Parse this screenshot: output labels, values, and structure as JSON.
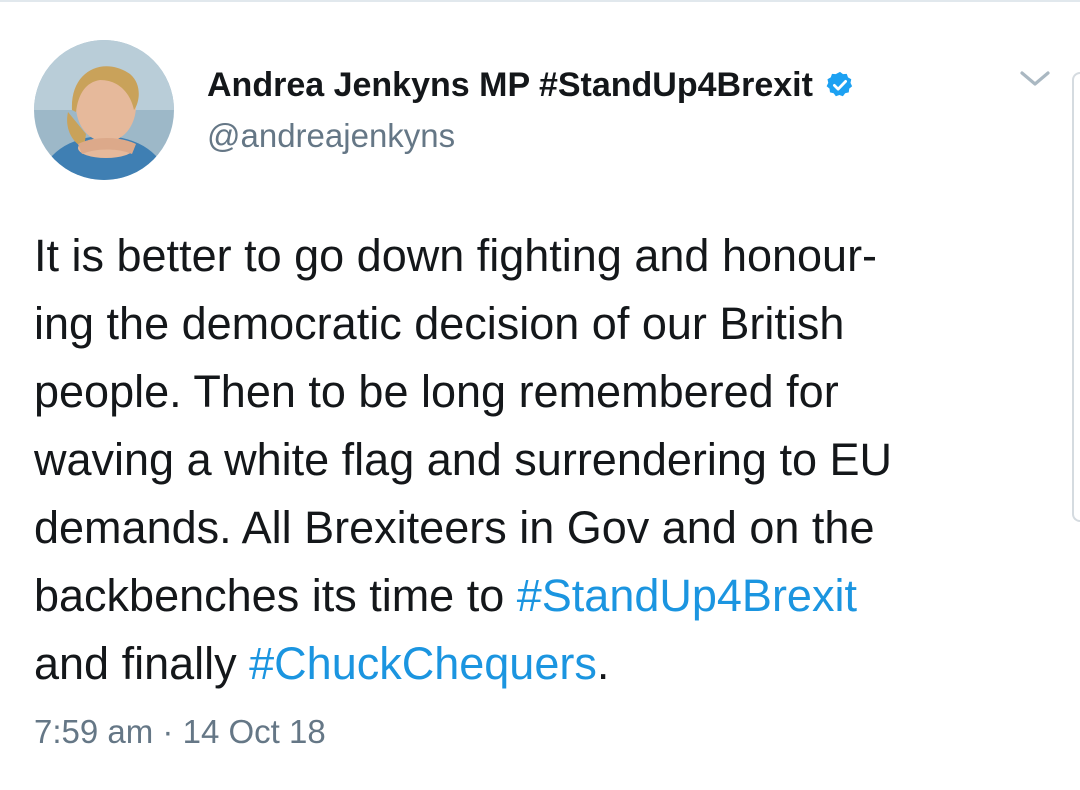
{
  "author": {
    "display_name": "Andrea Jenkyns MP #StandUp4Brexit",
    "handle": "@andreajenkyns",
    "verified": true
  },
  "tweet": {
    "lines": [
      {
        "text": "It is better to go down fighting and honour-"
      },
      {
        "text": "ing the democratic decision of our British"
      },
      {
        "text": "people. Then to be long remembered for"
      },
      {
        "text": "waving a white flag and surrendering to EU"
      },
      {
        "text": "demands. All Brexiteers in Gov and on the"
      },
      {
        "text": "backbenches its time to ",
        "hashtag": "#StandUp4Brexit"
      },
      {
        "text": "and finally ",
        "hashtag": "#ChuckChequers",
        "suffix": "."
      }
    ]
  },
  "meta": {
    "time": "7:59 am",
    "separator": "·",
    "date": "14 Oct 18"
  },
  "icons": {
    "verified": "verified-badge-icon",
    "menu": "chevron-down-icon"
  },
  "colors": {
    "text": "#14171a",
    "secondary": "#657786",
    "link": "#1b95e0",
    "verified": "#1da1f2"
  }
}
